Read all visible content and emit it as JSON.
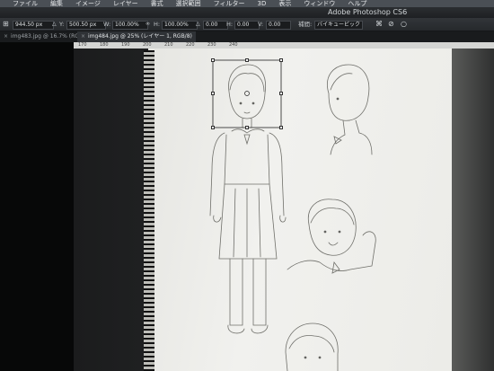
{
  "menu": [
    "ファイル",
    "編集",
    "イメージ",
    "レイヤー",
    "書式",
    "選択範囲",
    "フィルター",
    "3D",
    "表示",
    "ウィンドウ",
    "ヘルプ"
  ],
  "app_title": "Adobe Photoshop CS6",
  "options": {
    "x_value": "944.50 px",
    "y_label": "Y:",
    "y_value": "500.50 px",
    "w_label": "W:",
    "w_value": "100.00%",
    "h_label": "H:",
    "h_value": "100.00%",
    "angle_value": "0.00",
    "hskew_label": "H:",
    "hskew_value": "0.00",
    "vskew_label": "V:",
    "vskew_value": "0.00",
    "interp_label": "補間:",
    "interp_value": "バイキュービック"
  },
  "tabs": [
    {
      "label": "img483.jpg @ 16.7% (RGB/8)",
      "active": false
    },
    {
      "label": "img484.jpg @ 25% (レイヤー 1, RGB/8)",
      "active": true
    }
  ],
  "ruler": [
    "170",
    "180",
    "190",
    "200",
    "210",
    "220",
    "230",
    "240"
  ]
}
